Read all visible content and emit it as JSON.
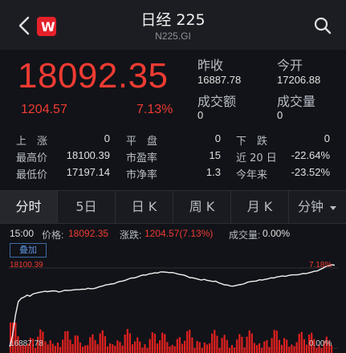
{
  "header": {
    "title": "日经 225",
    "code": "N225.GI",
    "logo_letter": "W"
  },
  "quote": {
    "price": "18092.35",
    "change": "1204.57",
    "change_pct": "7.13%",
    "prev_close_label": "昨收",
    "prev_close": "16887.78",
    "open_label": "今开",
    "open": "17206.88",
    "turnover_label": "成交额",
    "turnover": "0",
    "volume_label": "成交量",
    "volume": "0"
  },
  "stats": [
    {
      "label": "上　涨",
      "value": "0"
    },
    {
      "label": "平　盘",
      "value": "0"
    },
    {
      "label": "下　跌",
      "value": "0"
    },
    {
      "label": "最高价",
      "value": "18100.39"
    },
    {
      "label": "市盈率",
      "value": "15"
    },
    {
      "label": "近 20 日",
      "value": "-22.64%"
    },
    {
      "label": "最低价",
      "value": "17197.14"
    },
    {
      "label": "市净率",
      "value": "1.3"
    },
    {
      "label": "今年来",
      "value": "-23.52%"
    }
  ],
  "tabs": [
    "分时",
    "5日",
    "日 K",
    "周 K",
    "月 K",
    "分钟"
  ],
  "info": {
    "time": "15:00",
    "price_label": "价格:",
    "price": "18092.35",
    "change_label": "涨跌:",
    "change": "1204.57(7.13%)",
    "volume_label": "成交量:",
    "volume": "0.00%"
  },
  "overlay_label": "叠加",
  "chart_labels": {
    "top_price": "18100.39",
    "top_pct": "7.18%",
    "bottom_price": "16887.78",
    "bottom_pct": "0.00%"
  },
  "chart_data": {
    "type": "line",
    "title": "",
    "ylim": [
      16887.78,
      18100.39
    ],
    "series": [
      {
        "values": [
          16887.78,
          17050,
          17350,
          17560,
          17600,
          17620,
          17650,
          17640,
          17660,
          17680,
          17690,
          17700,
          17700,
          17705,
          17710,
          17715,
          17705,
          17700,
          17710,
          17720,
          17718,
          17725,
          17730,
          17728,
          17735,
          17740,
          17738,
          17745,
          17750,
          17748,
          17760,
          17770,
          17790,
          17800,
          17805,
          17812,
          17825,
          17838,
          17850,
          17860,
          17875,
          17890,
          17900,
          17910,
          17920,
          17935,
          17945,
          17955,
          17962,
          17970,
          17978,
          17985,
          17990,
          17992,
          17990,
          17988,
          17980,
          17975,
          17965,
          17955,
          17945,
          17930,
          17915,
          17905,
          17895,
          17885,
          17880,
          17878,
          17870,
          17862,
          17858,
          17850,
          17835,
          17820,
          17805,
          17795,
          17790,
          17785,
          17792,
          17800,
          17812,
          17825,
          17838,
          17850,
          17858,
          17862,
          17870,
          17878,
          17885,
          17892,
          17900,
          17910,
          17920,
          17925,
          17930,
          17935,
          17940,
          17946,
          17950,
          17955,
          17958,
          17965,
          17972,
          17980,
          17990,
          18000,
          18015,
          18030,
          18050,
          18075,
          18092.35,
          18100.39,
          18092.35
        ]
      }
    ],
    "colors": {
      "line": "#f2f2f2",
      "up": "#e1201e",
      "down": "#f03b32",
      "accent": "#5b8fd8"
    }
  }
}
